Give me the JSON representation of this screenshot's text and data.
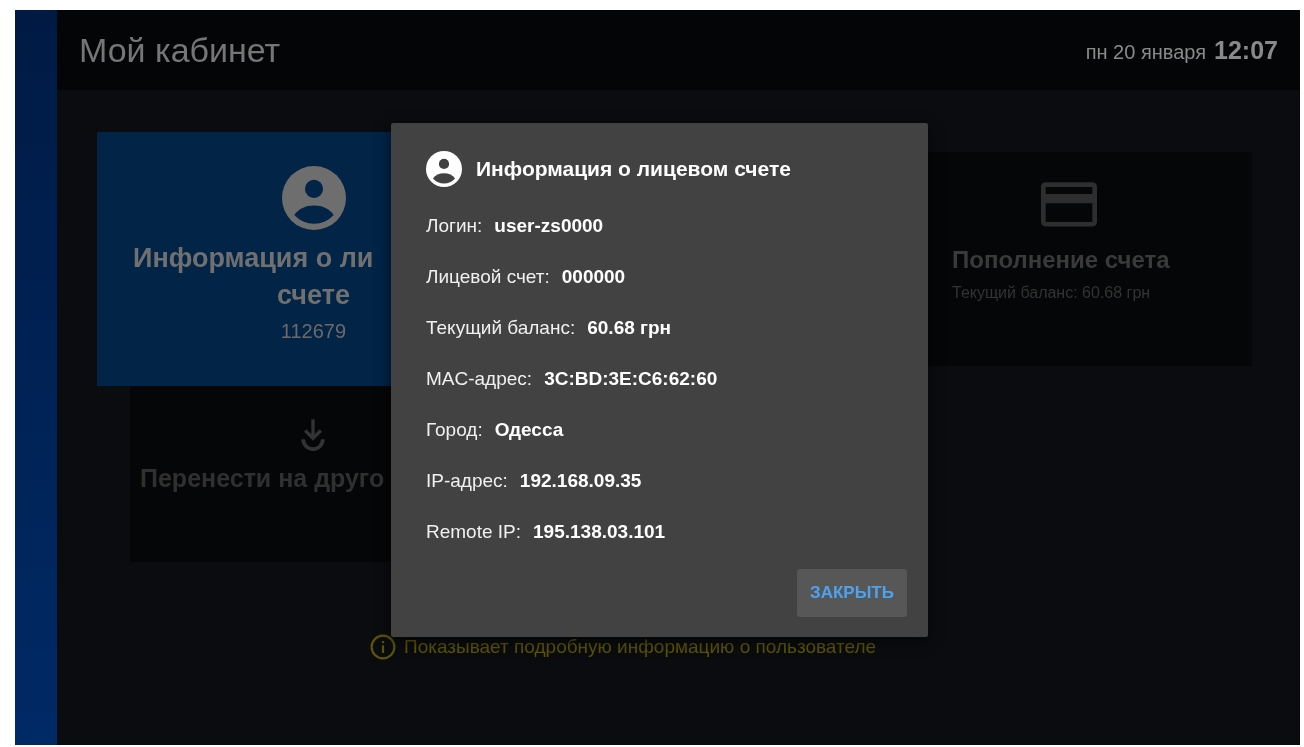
{
  "header": {
    "title": "Мой кабинет",
    "date": "пн 20 января",
    "time": "12:07"
  },
  "tiles": [
    {
      "kind": "account",
      "title_lines": [
        "Информация о ли",
        "счете"
      ],
      "subtitle": "112679",
      "selected": true
    },
    {
      "kind": "transfer",
      "title_lines": [
        "Перенести на друго"
      ],
      "selected": false
    },
    {
      "kind": "topup",
      "title_lines": [
        "Пополнение счета"
      ],
      "subtitle": "Текущий баланс: 60.68 грн",
      "selected": false
    }
  ],
  "hint": "Показывает подробную информацию о пользователе",
  "dialog": {
    "title": "Информация о лицевом счете",
    "rows": [
      {
        "label": "Логин:",
        "value": "user-zs0000"
      },
      {
        "label": "Лицевой счет:",
        "value": "000000"
      },
      {
        "label": "Текущий баланс:",
        "value": "60.68 грн"
      },
      {
        "label": "MAC-адрес:",
        "value": "3C:BD:3E:C6:62:60"
      },
      {
        "label": "Город:",
        "value": "Одесса"
      },
      {
        "label": "IP-адрес:",
        "value": "192.168.09.35"
      },
      {
        "label": "Remote IP:",
        "value": "195.138.03.101"
      }
    ],
    "close_button": "ЗАКРЫТЬ"
  }
}
